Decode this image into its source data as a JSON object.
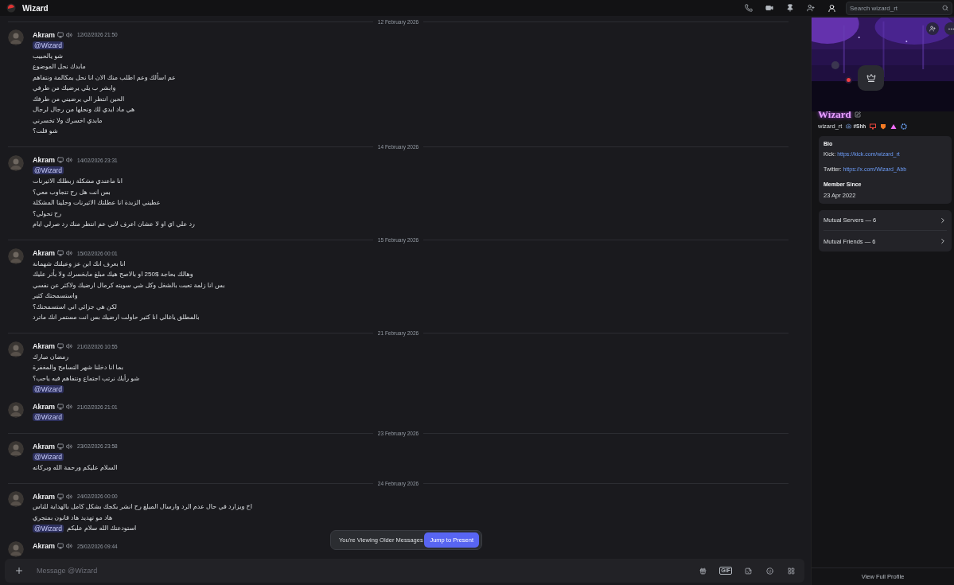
{
  "window": {
    "title": "Wizard"
  },
  "toolbar": {
    "search": {
      "placeholder": "Search wizard_rt"
    }
  },
  "timeline": [
    {
      "kind": "divider",
      "label": "12 February 2026"
    },
    {
      "kind": "message",
      "author": "Akram",
      "time": "12/02/2026 21:50",
      "lines": [
        {
          "mention": "@Wizard"
        },
        {
          "text": "شو يالحبيب"
        },
        {
          "text": "مابدك نحل الموضوع"
        },
        {
          "text": "عم اسألك وعم اطلب منك الان انا نحل بمكالمة ونتفاهم"
        },
        {
          "text": "وابشر ب يلي يرضيك من طرفي"
        },
        {
          "text": "الحين انتظر الي يرضيني من طرفك"
        },
        {
          "text": "هي ماد ايدي لك ونحلها من رجال لرجال"
        },
        {
          "text": "مابدي اخسرك ولا تخسرني"
        },
        {
          "text": "شو قلت؟"
        }
      ]
    },
    {
      "kind": "divider",
      "label": "14 February 2026"
    },
    {
      "kind": "message",
      "author": "Akram",
      "time": "14/02/2026 23:31",
      "lines": [
        {
          "mention": "@Wizard"
        },
        {
          "text": "انا ماعندي مشكلة زبطلك الاثيرنات"
        },
        {
          "text": "بس انت هل رح تتجاوب معي؟"
        },
        {
          "text": "عطيني الزبدة انا عطلتك الاثيرنات وحلينا المشكلة"
        },
        {
          "text": "رح تحولي؟"
        },
        {
          "text": "رد علي اي او لا عشان اعرف لاني عم انتظر منك رد صرلي ايام"
        }
      ]
    },
    {
      "kind": "divider",
      "label": "15 February 2026"
    },
    {
      "kind": "message",
      "author": "Akram",
      "time": "15/02/2026 00:01",
      "lines": [
        {
          "text": "انا بعرف انك ابن عز وعيلتك شهمانة"
        },
        {
          "text": "وهالك بحاجة $250 او بالاصح هيك مبلغ مابخسرك ولا بأثر عليك"
        },
        {
          "text": "بس انا زلمة تعبت بالشغل وكل شي سويته كرمال ارضيك ولاكثر عن نفسي"
        },
        {
          "text": "واستسمحتك كثير"
        },
        {
          "text": "لكن هي جزائي اني استسمحتك؟"
        },
        {
          "text": "بالمطلق ياغالي انا كثير حاولت ارضيك بس انت مستمر انك ماترد"
        }
      ]
    },
    {
      "kind": "divider",
      "label": "21 February 2026"
    },
    {
      "kind": "message",
      "author": "Akram",
      "time": "21/02/2026 10:55",
      "lines": [
        {
          "text": "رمضان مبارك"
        },
        {
          "text": "بما انا دخلنا شهر التسامح والمغفرة"
        },
        {
          "text": "شو رأيك نرتب اجتماع ونتفاهم فيه ياحب؟"
        },
        {
          "mention": "@Wizard"
        }
      ]
    },
    {
      "kind": "message",
      "author": "Akram",
      "time": "21/02/2026 21:01",
      "lines": [
        {
          "mention": "@Wizard"
        }
      ]
    },
    {
      "kind": "divider",
      "label": "23 February 2026"
    },
    {
      "kind": "message",
      "author": "Akram",
      "time": "23/02/2026 23:58",
      "lines": [
        {
          "mention": "@Wizard"
        },
        {
          "text": "السلام عليكم ورحمة الله وبركاته"
        }
      ]
    },
    {
      "kind": "divider",
      "label": "24 February 2026"
    },
    {
      "kind": "message",
      "author": "Akram",
      "time": "24/02/2026 00:00",
      "lines": [
        {
          "text": "اخ ويزارد في حال عدم الرد وارسال المبلغ رح انشر بكجك بشكل كامل بالهداية للناس"
        },
        {
          "text": "هاد مو تهديد هاد قانون بمتجري"
        },
        {
          "mention": "@Wizard",
          "text": "استودعتك الله سلام عليكم"
        }
      ]
    },
    {
      "kind": "message",
      "author": "Akram",
      "time": "25/02/2026 09:44"
    }
  ],
  "notice": {
    "text": "You're Viewing Older Messages",
    "button": "Jump to Present"
  },
  "composer": {
    "placeholder": "Message @Wizard",
    "gif": "GIF"
  },
  "profile": {
    "display_name": "Wizard",
    "username": "wizard_rt",
    "tag": "#Shh",
    "bio": {
      "heading": "Bio",
      "lines": [
        {
          "label": "Kick:",
          "link": "https://kick.com/wizard_rt"
        },
        {
          "label": "Twitter:",
          "link": "https://x.com/Wizard_Abb"
        }
      ]
    },
    "member_since": {
      "heading": "Member Since",
      "date": "23 Apr 2022"
    },
    "mutuals": [
      {
        "label": "Mutual Servers — 6"
      },
      {
        "label": "Mutual Friends — 6"
      }
    ],
    "footer": "View Full Profile"
  }
}
